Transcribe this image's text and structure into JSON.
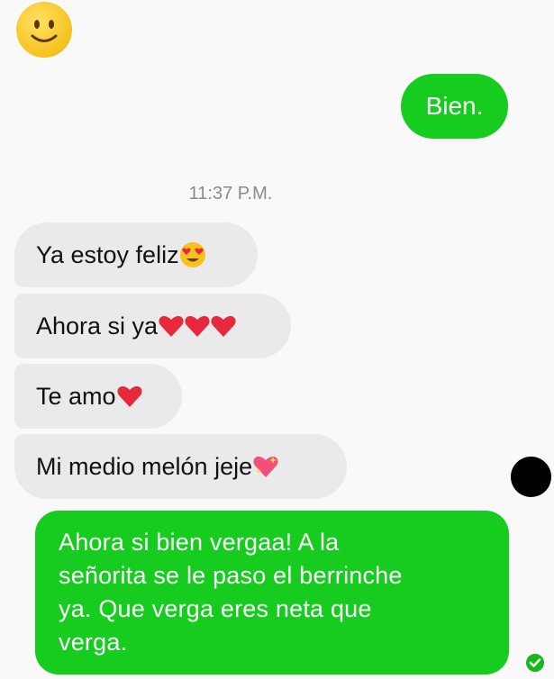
{
  "messages": {
    "sent_1": "Bien.",
    "timestamp": "11:37 P.M.",
    "received": [
      {
        "text": "Ya estoy feliz",
        "emoji": "heart-eyes-face-icon"
      },
      {
        "text": "Ahora si ya",
        "emoji": "red-heart-icon x3"
      },
      {
        "text": "Te amo",
        "emoji": "red-heart-icon"
      },
      {
        "text": "Mi medio melón jeje",
        "emoji": "sparkling-heart-icon"
      }
    ],
    "sent_2_lines": [
      "Ahora si bien vergaa! A la",
      "señorita se le paso el berrinche",
      "ya. Que verga eres neta que",
      "verga."
    ]
  },
  "colors": {
    "outgoing_bubble": "#15cc1f",
    "incoming_bubble": "#eaeaea",
    "background": "#f9f9f9",
    "heart": "#e8293b"
  }
}
